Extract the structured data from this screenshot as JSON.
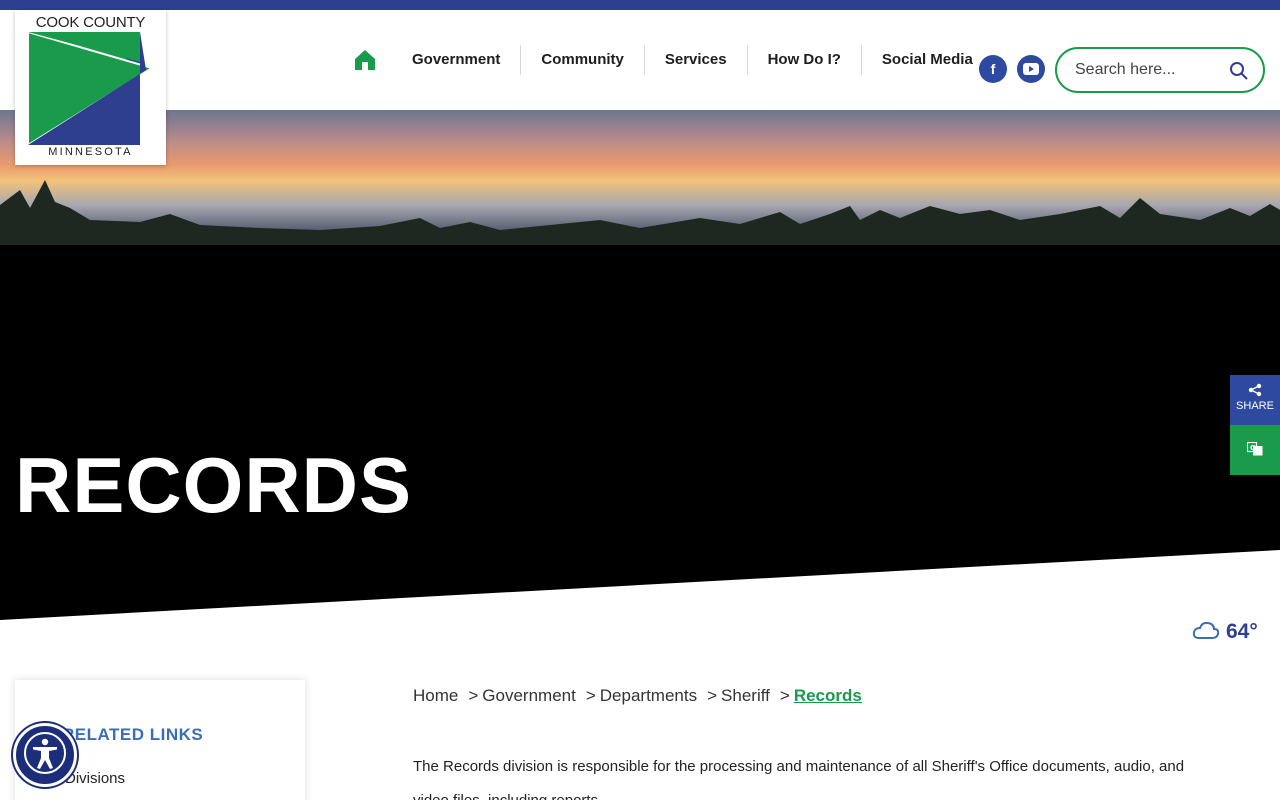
{
  "logo": {
    "top_text": "COOK COUNTY",
    "bottom_text": "MINNESOTA"
  },
  "nav": {
    "home_icon": "home-icon",
    "items": [
      "Government",
      "Community",
      "Services",
      "How Do I?",
      "Social Media"
    ]
  },
  "social": {
    "facebook": "f",
    "youtube": "▶"
  },
  "search": {
    "placeholder": "Search here..."
  },
  "hero": {
    "title": "RECORDS"
  },
  "side_tabs": {
    "share_label": "SHARE",
    "translate_icon": "translate-icon"
  },
  "weather": {
    "temperature": "64°",
    "icon": "cloud-icon"
  },
  "sidebar": {
    "title": "RELATED LINKS",
    "links": [
      "Divisions"
    ]
  },
  "breadcrumb": {
    "items": [
      "Home",
      "Government",
      "Departments",
      "Sheriff",
      "Records"
    ],
    "separator": ">"
  },
  "content": {
    "paragraph": "The Records division is responsible for the processing and maintenance of all Sheriff's Office documents, audio, and video files, including reports."
  },
  "colors": {
    "brand_blue": "#2e3f8f",
    "brand_green": "#1a9b4b",
    "hero_bg": "#000000"
  }
}
